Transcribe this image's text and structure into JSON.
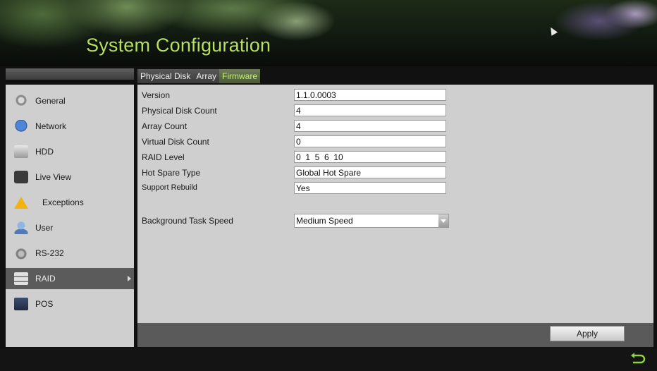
{
  "header": {
    "title": "System Configuration"
  },
  "tabs": [
    {
      "label": "Physical Disk",
      "active": false
    },
    {
      "label": "Array",
      "active": false
    },
    {
      "label": "Firmware",
      "active": true
    }
  ],
  "sidebar": {
    "items": [
      {
        "label": "General",
        "icon": "general-icon"
      },
      {
        "label": "Network",
        "icon": "network-icon"
      },
      {
        "label": "HDD",
        "icon": "hdd-icon"
      },
      {
        "label": "Live View",
        "icon": "live-view-icon"
      },
      {
        "label": "Exceptions",
        "icon": "warning-icon"
      },
      {
        "label": "User",
        "icon": "user-icon"
      },
      {
        "label": "RS-232",
        "icon": "rs232-icon"
      },
      {
        "label": "RAID",
        "icon": "raid-icon",
        "active": true
      },
      {
        "label": "POS",
        "icon": "pos-icon"
      }
    ]
  },
  "firmware": {
    "version_label": "Version",
    "version_value": "1.1.0.0003",
    "physical_disk_count_label": "Physical Disk Count",
    "physical_disk_count_value": "4",
    "array_count_label": "Array Count",
    "array_count_value": "4",
    "virtual_disk_count_label": "Virtual Disk Count",
    "virtual_disk_count_value": "0",
    "raid_level_label": "RAID Level",
    "raid_level_value": "0  1  5  6  10",
    "hot_spare_type_label": "Hot Spare Type",
    "hot_spare_type_value": "Global Hot Spare",
    "support_rebuild_label": "Support Rebuild",
    "support_rebuild_value": "Yes",
    "background_task_speed_label": "Background Task Speed",
    "background_task_speed_value": "Medium Speed"
  },
  "footer": {
    "apply_label": "Apply"
  },
  "colors": {
    "title": "#b8e05a",
    "active_tab_text": "#c8f07a",
    "panel_bg": "#cfcfcf"
  }
}
